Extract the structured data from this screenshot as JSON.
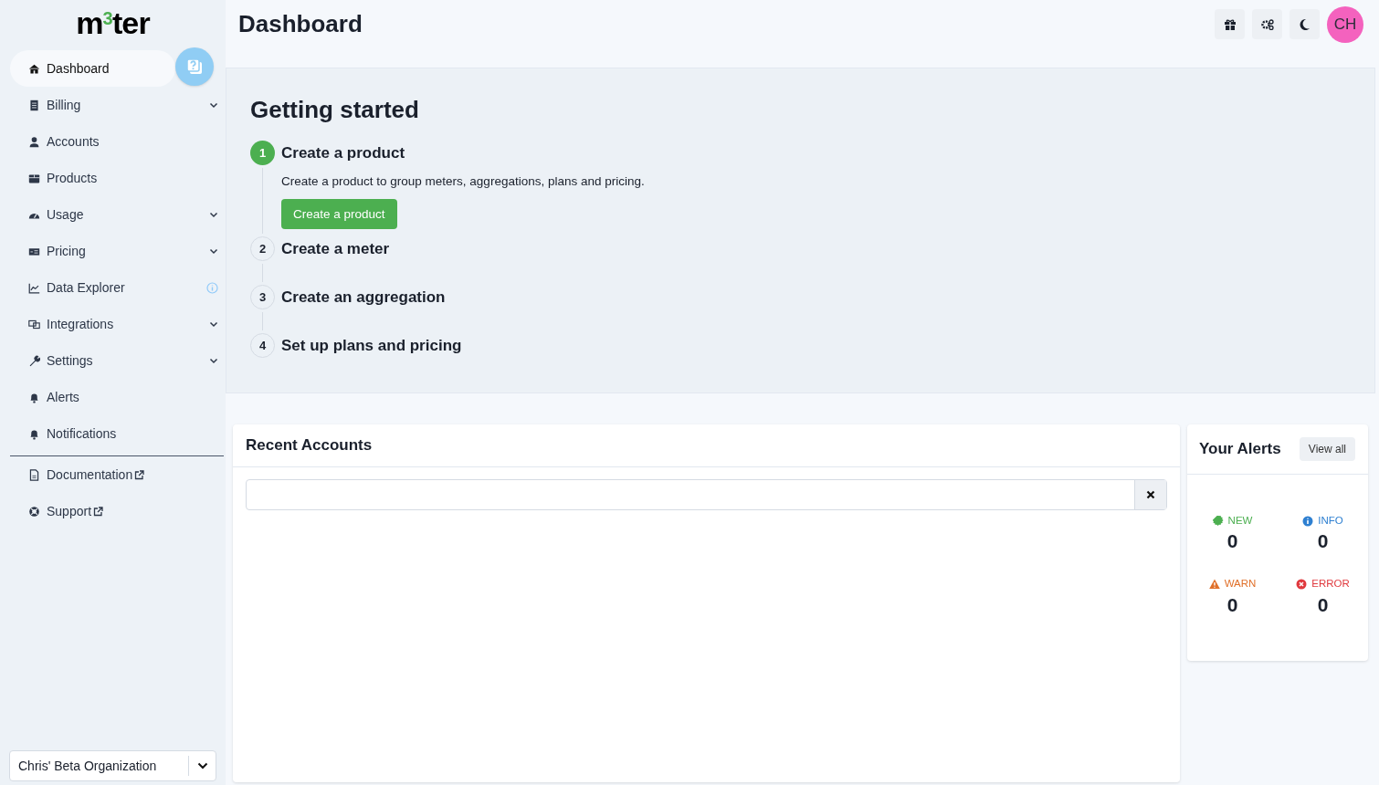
{
  "logo": "m$^{3}$ter",
  "sidebar": {
    "items": [
      {
        "label": "Dashboard",
        "selected": true,
        "expandable": false,
        "info": false
      },
      {
        "label": "Billing",
        "selected": false,
        "expandable": true,
        "info": false
      },
      {
        "label": "Accounts",
        "selected": false,
        "expandable": false,
        "info": false
      },
      {
        "label": "Products",
        "selected": false,
        "expandable": false,
        "info": false
      },
      {
        "label": "Usage",
        "selected": false,
        "expandable": true,
        "info": false
      },
      {
        "label": "Pricing",
        "selected": false,
        "expandable": true,
        "info": false
      },
      {
        "label": "Data Explorer",
        "selected": false,
        "expandable": false,
        "info": true
      },
      {
        "label": "Integrations",
        "selected": false,
        "expandable": true,
        "info": false
      },
      {
        "label": "Settings",
        "selected": false,
        "expandable": true,
        "info": false
      },
      {
        "label": "Alerts",
        "selected": false,
        "expandable": false,
        "info": false
      },
      {
        "label": "Notifications",
        "selected": false,
        "expandable": false,
        "info": false
      }
    ],
    "links": [
      {
        "label": "Documentation"
      },
      {
        "label": "Support"
      }
    ],
    "organization": "Chris' Beta Organization"
  },
  "header": {
    "title": "Dashboard",
    "avatar": "CH"
  },
  "getting_started": {
    "title": "Getting started",
    "steps": [
      {
        "number": "1",
        "title": "Create a product",
        "active": true,
        "description": "Create a product to group meters, aggregations, plans and pricing.",
        "button": "Create a product"
      },
      {
        "number": "2",
        "title": "Create a meter",
        "active": false
      },
      {
        "number": "3",
        "title": "Create an aggregation",
        "active": false
      },
      {
        "number": "4",
        "title": "Set up plans and pricing",
        "active": false
      }
    ]
  },
  "recent_accounts": {
    "title": "Recent Accounts"
  },
  "alerts": {
    "title": "Your Alerts",
    "button": "View all",
    "items": [
      {
        "kind": "new",
        "label": "NEW",
        "count": "0",
        "color": "#4caf50"
      },
      {
        "kind": "info",
        "label": "INFO",
        "count": "0",
        "color": "#2f80d1"
      },
      {
        "kind": "warn",
        "label": "WARN",
        "count": "0",
        "color": "#e0702a"
      },
      {
        "kind": "error",
        "label": "ERROR",
        "count": "0",
        "color": "#e0393e"
      }
    ]
  }
}
